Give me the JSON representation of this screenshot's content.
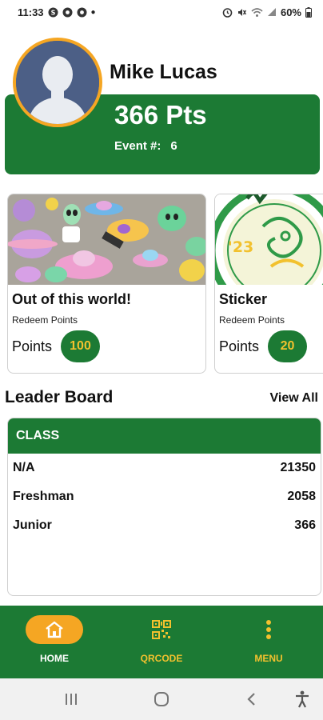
{
  "status_bar": {
    "time": "11:33",
    "battery": "60%"
  },
  "profile": {
    "name": "Mike Lucas",
    "points": "366 Pts",
    "event_label": "Event #:",
    "event_value": "6"
  },
  "rewards": [
    {
      "title": "Out of this world!",
      "subtitle": "Redeem Points",
      "points_label": "Points",
      "points": "100"
    },
    {
      "title": "Sticker",
      "subtitle": "Redeem Points",
      "points_label": "Points",
      "points": "20",
      "image_text": "'23"
    }
  ],
  "leaderboard": {
    "title": "Leader Board",
    "view_all": "View All",
    "header": "CLASS",
    "rows": [
      {
        "name": "N/A",
        "score": "21350"
      },
      {
        "name": "Freshman",
        "score": "2058"
      },
      {
        "name": "Junior",
        "score": "366"
      }
    ]
  },
  "nav": {
    "items": [
      {
        "label": "HOME",
        "icon": "home-icon"
      },
      {
        "label": "QRCODE",
        "icon": "qr-code-icon"
      },
      {
        "label": "MENU",
        "icon": "more-vertical-icon"
      }
    ]
  },
  "colors": {
    "brand_green": "#1c7a34",
    "accent_orange": "#f5a623",
    "accent_yellow": "#f2c12e"
  }
}
